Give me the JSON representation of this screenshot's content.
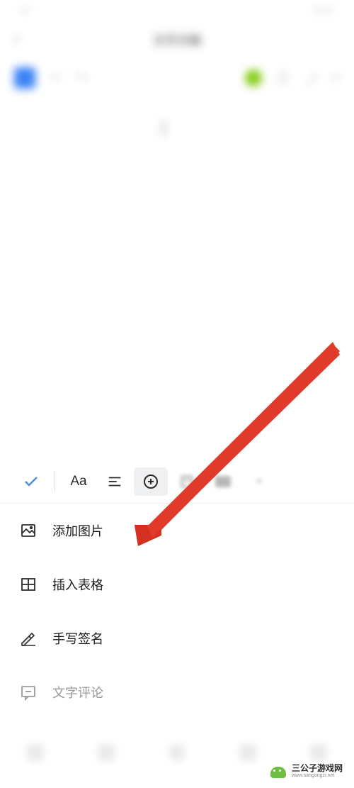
{
  "header": {
    "title": "文字文稿"
  },
  "toolbar": {
    "check": "check",
    "text": "Aa",
    "align": "align",
    "insert": "insert",
    "note": "note"
  },
  "menu": {
    "items": [
      {
        "icon": "image",
        "label": "添加图片",
        "muted": false
      },
      {
        "icon": "table",
        "label": "插入表格",
        "muted": false
      },
      {
        "icon": "signature",
        "label": "手写签名",
        "muted": false
      },
      {
        "icon": "comment",
        "label": "文字评论",
        "muted": true
      }
    ]
  },
  "watermark": {
    "name": "三公子游戏网",
    "url": "www.sangongzi.net"
  }
}
